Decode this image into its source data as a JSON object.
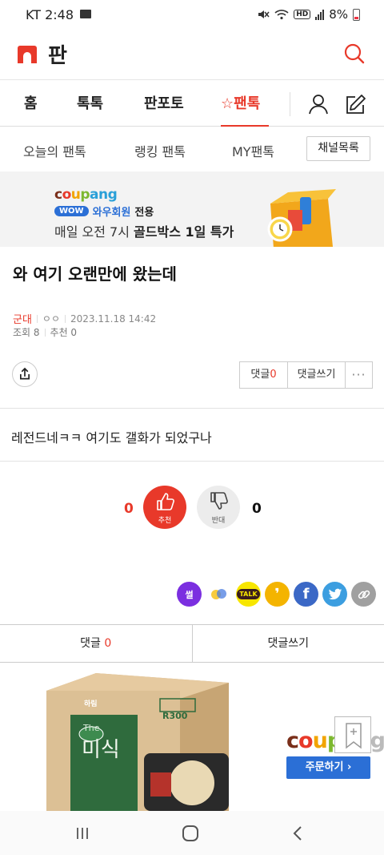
{
  "status": {
    "carrier_time": "KT 2:48",
    "hd": "HD",
    "battery": "8%"
  },
  "header": {
    "logo_text": "판"
  },
  "tabs": [
    {
      "label": "홈"
    },
    {
      "label": "톡톡"
    },
    {
      "label": "판포토"
    },
    {
      "label": "☆팬톡",
      "active": true
    }
  ],
  "subtabs": [
    {
      "label": "오늘의 팬톡"
    },
    {
      "label": "랭킹 팬톡"
    },
    {
      "label": "MY팬톡"
    }
  ],
  "channel_button": "채널목록",
  "banner": {
    "brand": "coupang",
    "wow": "WOW",
    "wow_member": "와우회원",
    "wow_only": "전용",
    "line_plain": "매일 오전 7시 ",
    "line_bold": "골드박스 1일 특가"
  },
  "post": {
    "title": "와 여기 오랜만에 왔는데",
    "category": "군대",
    "author": "ㅇㅇ",
    "datetime": "2023.11.18 14:42",
    "views": "조회 8",
    "recommends": "추천 0",
    "body": "레전드네ㅋㅋ 여기도 갤화가 되었구나"
  },
  "actions": {
    "comment_label": "댓글",
    "comment_count": "0",
    "write_label": "댓글쓰기",
    "more": "···"
  },
  "votes": {
    "up_count": "0",
    "up_label": "추천",
    "down_count": "0",
    "down_label": "반대"
  },
  "sns": [
    {
      "name": "ssul",
      "label": "썰",
      "color": "#7b2fe0"
    },
    {
      "name": "band",
      "label": "",
      "color": "#ffffff"
    },
    {
      "name": "kakaotalk",
      "label": "TALK",
      "color": "#f7e600"
    },
    {
      "name": "kakaostory",
      "label": "❜",
      "color": "#f4b400"
    },
    {
      "name": "facebook",
      "label": "f",
      "color": "#3b68c6"
    },
    {
      "name": "twitter",
      "label": "",
      "color": "#3c9ee0"
    },
    {
      "name": "link",
      "label": "",
      "color": "#a0a0a0"
    }
  ],
  "comment_bar": {
    "comment_label": "댓글",
    "comment_count": "0",
    "write_label": "댓글쓰기"
  },
  "ad2": {
    "brand": "coupang",
    "order_button": "주문하기 ›",
    "product_brand": "하림",
    "product_line": "The",
    "product_name": "미식",
    "product_code": "R300"
  },
  "colors": {
    "accent": "#e8392a",
    "coupang_blue": "#2b6fd6"
  }
}
